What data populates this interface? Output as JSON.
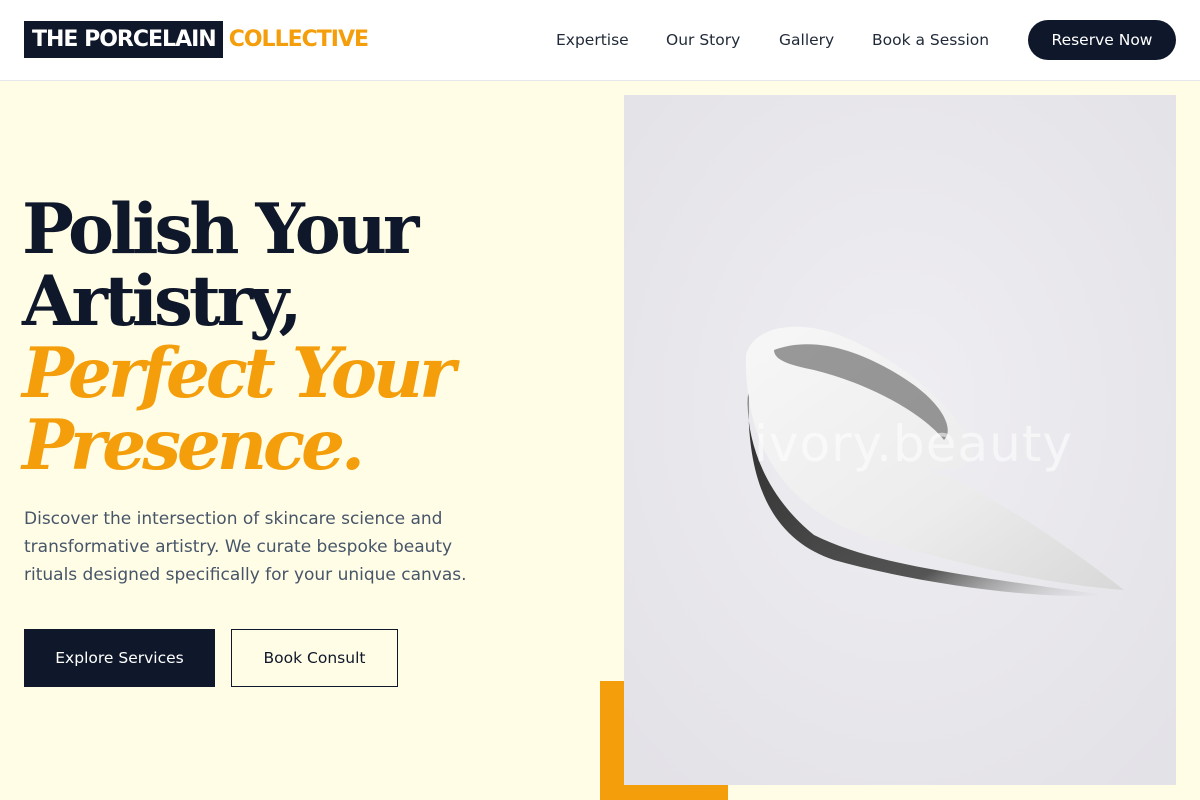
{
  "brand": {
    "name_primary": "THE PORCELAIN",
    "name_accent": "COLLECTIVE"
  },
  "nav": {
    "items": [
      {
        "label": "Expertise"
      },
      {
        "label": "Our Story"
      },
      {
        "label": "Gallery"
      },
      {
        "label": "Book a Session"
      }
    ],
    "cta_label": "Reserve Now"
  },
  "hero": {
    "headline_line1": "Polish Your",
    "headline_line2": "Artistry,",
    "headline_accent_line1": "Perfect Your",
    "headline_accent_line2": "Presence.",
    "description": "Discover the intersection of skincare science and transformative artistry. We curate bespoke beauty rituals designed specifically for your unique canvas.",
    "primary_button": "Explore Services",
    "secondary_button": "Book Consult",
    "image_watermark": "ivory.beauty"
  },
  "colors": {
    "accent": "#f59e0b",
    "navy": "#0f172a",
    "background": "#fffde6"
  }
}
